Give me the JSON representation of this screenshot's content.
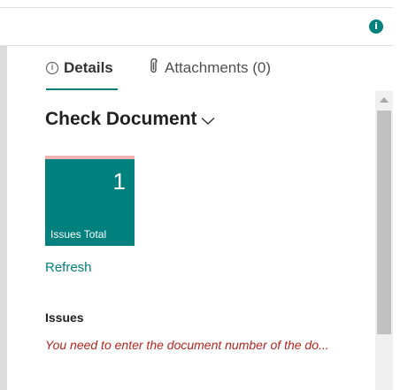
{
  "header": {
    "info_icon_glyph": "i"
  },
  "tabs": [
    {
      "label": "Details",
      "icon": "info-circle-icon",
      "active": true
    },
    {
      "label": "Attachments (0)",
      "icon": "paperclip-icon",
      "active": false
    }
  ],
  "check_document": {
    "title": "Check Document",
    "cue": {
      "value": "1",
      "label": "Issues Total",
      "color": "#00817e",
      "indicator_color": "#f0b3b3"
    },
    "refresh_label": "Refresh",
    "issues_heading": "Issues",
    "issue_message": "You need to enter the document number of the do..."
  },
  "colors": {
    "accent": "#00817e",
    "error": "#b3261e"
  }
}
